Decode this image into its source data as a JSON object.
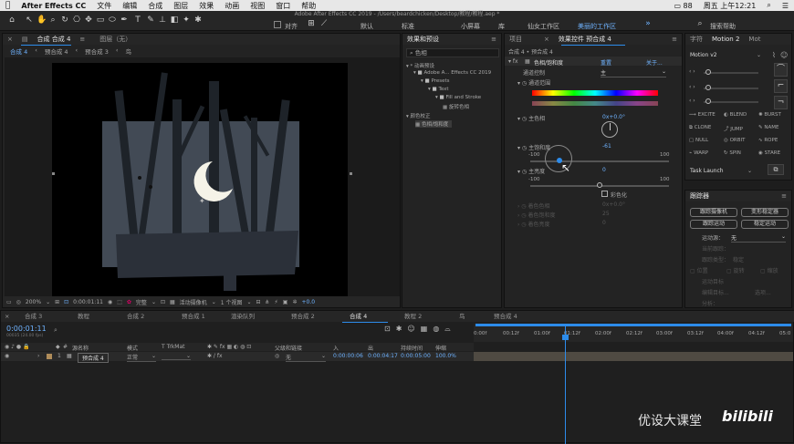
{
  "menubar": {
    "app": "After Effects CC",
    "items": [
      "文件",
      "编辑",
      "合成",
      "图层",
      "效果",
      "动画",
      "视图",
      "窗口",
      "帮助"
    ],
    "battery": "88",
    "clock": "周五 上午12:21"
  },
  "window_title": "Adobe After Effects CC 2019 - /Users/beardchicken/Desktop/教程/教程.aep *",
  "toolbar": {
    "snap_label": "对齐",
    "workspaces": [
      "默认",
      "标准",
      "小屏幕",
      "库",
      "仙女工作区",
      "美丽的工作区"
    ],
    "active_workspace": "美丽的工作区",
    "search_placeholder": "搜索帮助"
  },
  "comp_panel": {
    "tab_comp": "合成 合成 4",
    "tab_layer": "图层（无）",
    "breadcrumbs": [
      "合成 4",
      "预合成 4",
      "预合成 3",
      "鸟"
    ],
    "bottom": {
      "zoom": "200%",
      "time": "0:00:01:11",
      "quality": "完整",
      "camera": "活动摄像机",
      "views": "1 个视图",
      "exposure": "+0.0"
    }
  },
  "effects_presets": {
    "title": "效果和预设",
    "search_value": "色相",
    "tree": [
      "* 动画预设",
      "Adobe A... Effects CC 2019",
      "Presets",
      "Text",
      "Fill and Stroke",
      "旋转色相",
      "颜色校正",
      "色相/饱和度"
    ]
  },
  "effect_controls": {
    "tab_project": "项目",
    "tab": "效果控件 预合成 4",
    "layer": "合成 4 • 预合成 4",
    "fx_name": "色相/饱和度",
    "reset": "重置",
    "about": "关于...",
    "channel_label": "通道控制",
    "channel_value": "主",
    "channel_range": "通道范围",
    "master_hue_label": "主色相",
    "master_hue_value": "0x+0.0°",
    "master_sat_label": "主饱和度",
    "master_sat_value": "-61",
    "sat_min": "-100",
    "sat_max": "100",
    "master_light_label": "主亮度",
    "master_light_value": "0",
    "light_min": "-100",
    "light_max": "100",
    "colorize_label": "彩色化",
    "dim": [
      {
        "label": "着色色相",
        "value": "0x+0.0°"
      },
      {
        "label": "着色饱和度",
        "value": "25"
      },
      {
        "label": "着色亮度",
        "value": "0"
      }
    ]
  },
  "character_panel": {
    "tabs": [
      "字符",
      "Motion 2",
      "Mot"
    ],
    "title": "Motion v2",
    "buttons": [
      "EXCITE",
      "BLEND",
      "BURST",
      "CLONE",
      "JUMP",
      "NAME",
      "NULL",
      "ORBIT",
      "ROPE",
      "WARP",
      "SPIN",
      "STARE"
    ],
    "task": "Task Launch"
  },
  "tracker": {
    "title": "跟踪器",
    "buttons": [
      "跟踪摄像机",
      "变形稳定器",
      "跟踪运动",
      "稳定运动"
    ],
    "motion_source_label": "运动源：",
    "motion_source_value": "无",
    "current_track_label": "当前跟踪：",
    "track_type_label": "跟踪类型：",
    "track_type_value": "稳定",
    "position": "位置",
    "rotation": "旋转",
    "scale": "缩放",
    "target": "运动目标",
    "edit_target": "编辑目标...",
    "options": "选项...",
    "analyze": "分析："
  },
  "timeline": {
    "tabs": [
      "合成 3",
      "教程",
      "合成 2",
      "预合成 1",
      "渲染队列",
      "预合成 2",
      "合成 4",
      "教程 2",
      "鸟",
      "预合成 4"
    ],
    "active_tab": "合成 4",
    "time": "0:00:01:11",
    "fps": "00035 (24.00 fps)",
    "columns": [
      "源名称",
      "模式",
      "T TrkMat",
      "父级和链接",
      "入",
      "出",
      "持续时间",
      "伸缩"
    ],
    "layer": {
      "num": "1",
      "name": "预合成 4",
      "mode": "正常",
      "parent": "无",
      "in": "0:00:00:06",
      "out": "0:00:04:17",
      "duration": "0:00:05:00",
      "stretch": "100.0%"
    },
    "ruler": [
      "0:00f",
      "00:12f",
      "01:00f",
      "01:12f",
      "02:00f",
      "02:12f",
      "03:00f",
      "03:12f",
      "04:00f",
      "04:12f",
      "05:0"
    ]
  },
  "watermark": "优设大课堂",
  "logo_text": "bilibili"
}
